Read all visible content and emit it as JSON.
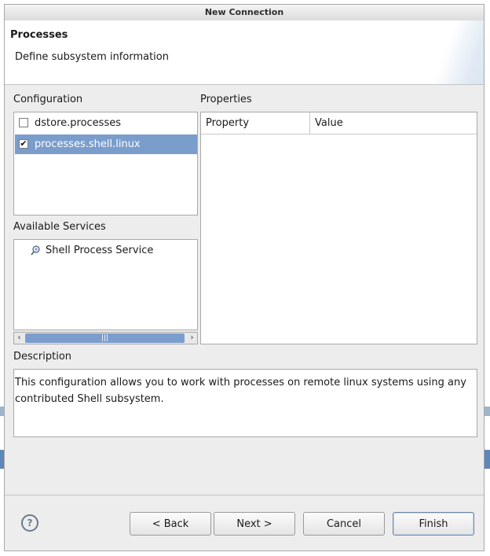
{
  "window": {
    "title": "New Connection"
  },
  "banner": {
    "title": "Processes",
    "description": "Define subsystem information"
  },
  "configuration": {
    "label": "Configuration",
    "items": [
      {
        "label": "dstore.processes",
        "checked": false,
        "selected": false
      },
      {
        "label": "processes.shell.linux",
        "checked": true,
        "selected": true
      }
    ]
  },
  "properties": {
    "label": "Properties",
    "columns": [
      "Property",
      "Value"
    ]
  },
  "services": {
    "label": "Available Services",
    "items": [
      {
        "label": "Shell Process Service",
        "icon": "shell-service-icon"
      }
    ]
  },
  "description": {
    "label": "Description",
    "text": "This configuration allows you to work with processes on remote linux systems using any contributed Shell subsystem."
  },
  "buttons": {
    "back": "< Back",
    "next": "Next >",
    "cancel": "Cancel",
    "finish": "Finish",
    "help": "?"
  },
  "colors": {
    "selection": "#7b9dcc",
    "dialog_bg": "#ededed"
  }
}
